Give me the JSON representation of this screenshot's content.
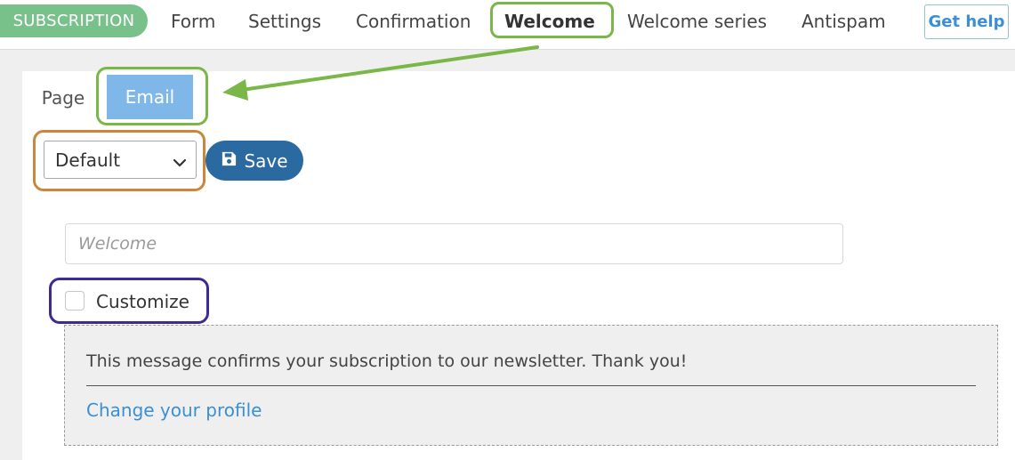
{
  "nav": {
    "brand": "SUBSCRIPTION",
    "items": [
      "Form",
      "Settings",
      "Confirmation",
      "Welcome",
      "Welcome series",
      "Antispam"
    ],
    "help_label": "Get help"
  },
  "tabs": {
    "page": "Page",
    "email": "Email"
  },
  "toolbar": {
    "select_value": "Default",
    "save_label": "Save"
  },
  "form": {
    "subject_placeholder": "Welcome",
    "customize_label": "Customize"
  },
  "preview": {
    "message": "This message confirms your subscription to our newsletter. Thank you!",
    "link": "Change your profile"
  },
  "colors": {
    "brand_green": "#79c18b",
    "tab_active": "#7fb8e8",
    "save_button": "#2b6aa0",
    "link_blue": "#3b8fd6",
    "annotation_green": "#7ab648",
    "annotation_orange": "#c8873d",
    "annotation_purple": "#3d2a98"
  }
}
